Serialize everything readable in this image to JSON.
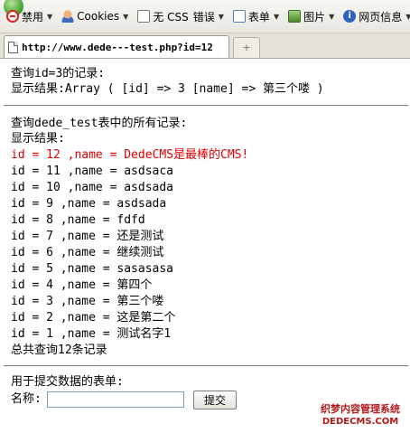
{
  "toolbar": {
    "items": [
      {
        "label": "禁用",
        "icon": "ban-icon"
      },
      {
        "label": "Cookies",
        "icon": "cookie-icon"
      },
      {
        "label": "无 CSS",
        "icon": "css-icon"
      },
      {
        "label": "错误"
      },
      {
        "label": "表单",
        "icon": "form-icon"
      },
      {
        "label": "图片",
        "icon": "image-icon"
      },
      {
        "label": "网页信息",
        "icon": "info-icon"
      }
    ]
  },
  "tab": {
    "url": "http://www.dede---test.php?id=12",
    "new_tab_symbol": "+"
  },
  "page": {
    "query_title": "查询id=3的记录:",
    "query_result": "显示结果:Array ( [id] => 3 [name] => 第三个喽 )",
    "all_title": "查询dede_test表中的所有记录:",
    "all_result_label": "显示结果:",
    "records": [
      "id = 12 ,name = DedeCMS是最棒的CMS!",
      "id = 11 ,name = asdsaca",
      "id = 10 ,name = asdsada",
      "id = 9 ,name = asdsada",
      "id = 8 ,name = fdfd",
      "id = 7 ,name = 还是测试",
      "id = 6 ,name = 继续测试",
      "id = 5 ,name = sasasasa",
      "id = 4 ,name = 第四个",
      "id = 3 ,name = 第三个喽",
      "id = 2 ,name = 这是第二个",
      "id = 1 ,name = 测试名字1"
    ],
    "total": "总共查询12条记录",
    "form_title": "用于提交数据的表单:",
    "name_label": "名称:",
    "name_value": "",
    "submit_label": "提交"
  },
  "watermark": {
    "line1": "织梦内容管理系统",
    "line2": "DEDECMS.COM"
  },
  "colors": {
    "highlight_record": "#e00000",
    "watermark": "#b21818"
  }
}
